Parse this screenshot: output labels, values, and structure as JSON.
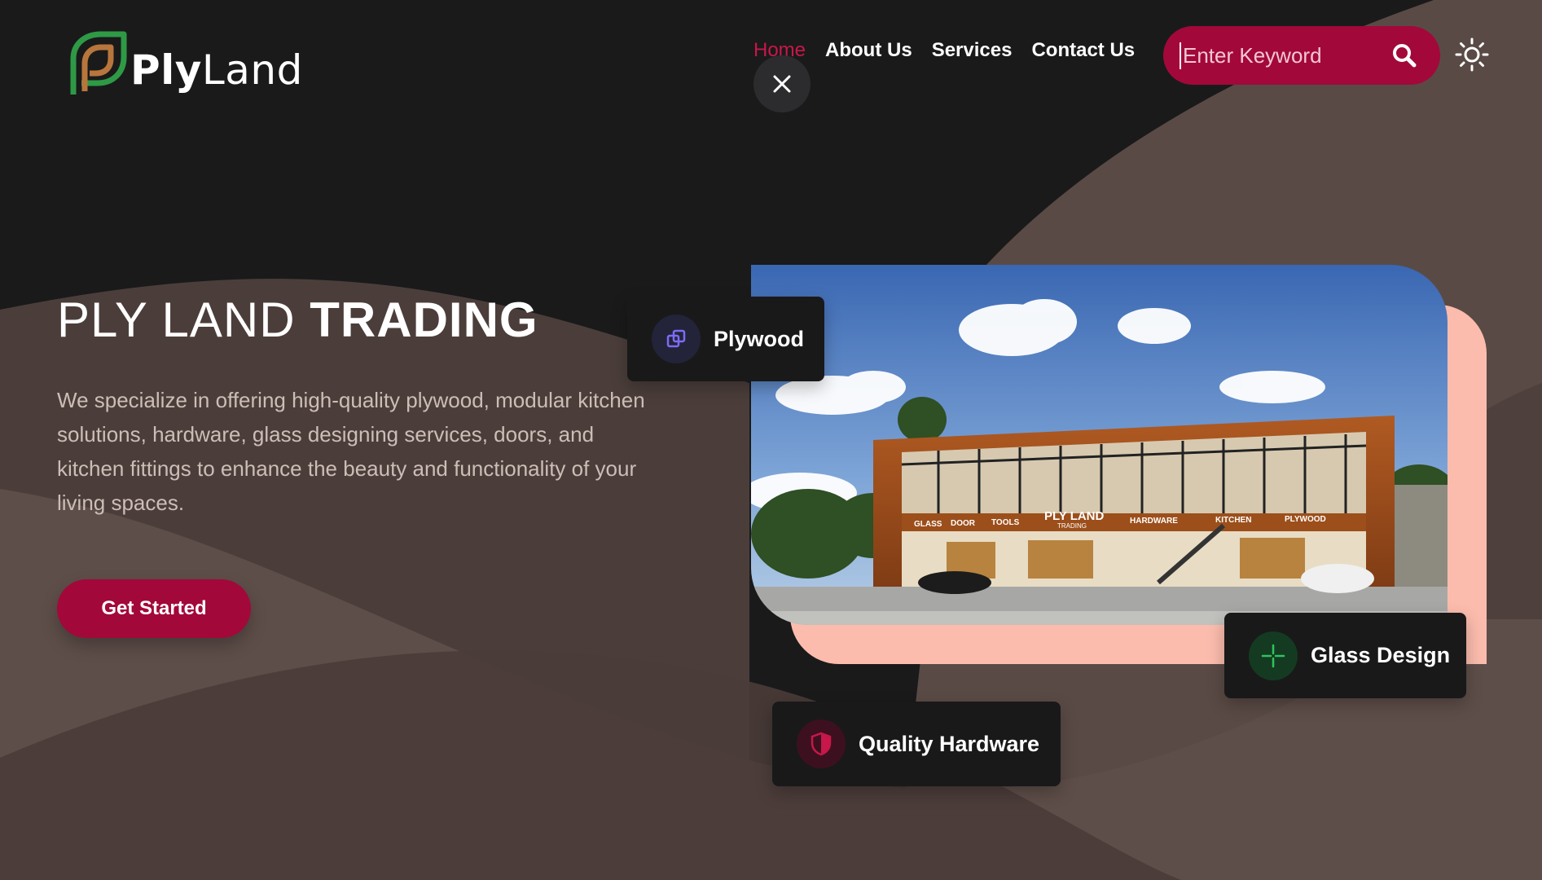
{
  "brand": {
    "name_bold": "Ply",
    "name_light": "Land"
  },
  "nav": {
    "items": [
      {
        "label": "Home",
        "active": true
      },
      {
        "label": "About Us",
        "active": false
      },
      {
        "label": "Services",
        "active": false
      },
      {
        "label": "Contact Us",
        "active": false
      }
    ]
  },
  "search": {
    "placeholder": "Enter Keyword",
    "value": ""
  },
  "icons": {
    "close": "close-icon",
    "search": "search-icon",
    "theme": "sun-icon",
    "plywood": "layers-icon",
    "glass": "crosshair-icon",
    "hardware": "shield-icon"
  },
  "hero": {
    "title_light": "PLY LAND",
    "title_bold": "TRADING",
    "description": "We specialize in offering high-quality plywood, modular kitchen solutions, hardware, glass designing services, doors, and kitchen fittings to enhance the beauty and functionality of your living spaces.",
    "cta_label": "Get Started"
  },
  "building_sign": {
    "main": "PLY LAND",
    "sub": "TRADING",
    "sections": [
      "GLASS",
      "DOOR",
      "TOOLS",
      "HARDWARE",
      "KITCHEN",
      "PLYWOOD"
    ]
  },
  "features": [
    {
      "label": "Plywood"
    },
    {
      "label": "Glass Design"
    },
    {
      "label": "Quality Hardware"
    }
  ],
  "colors": {
    "accent": "#a3083a",
    "active_nav": "#c8174a",
    "background": "#1a1a1b",
    "wave": "#5c4c47",
    "peach": "#fbbcad"
  }
}
